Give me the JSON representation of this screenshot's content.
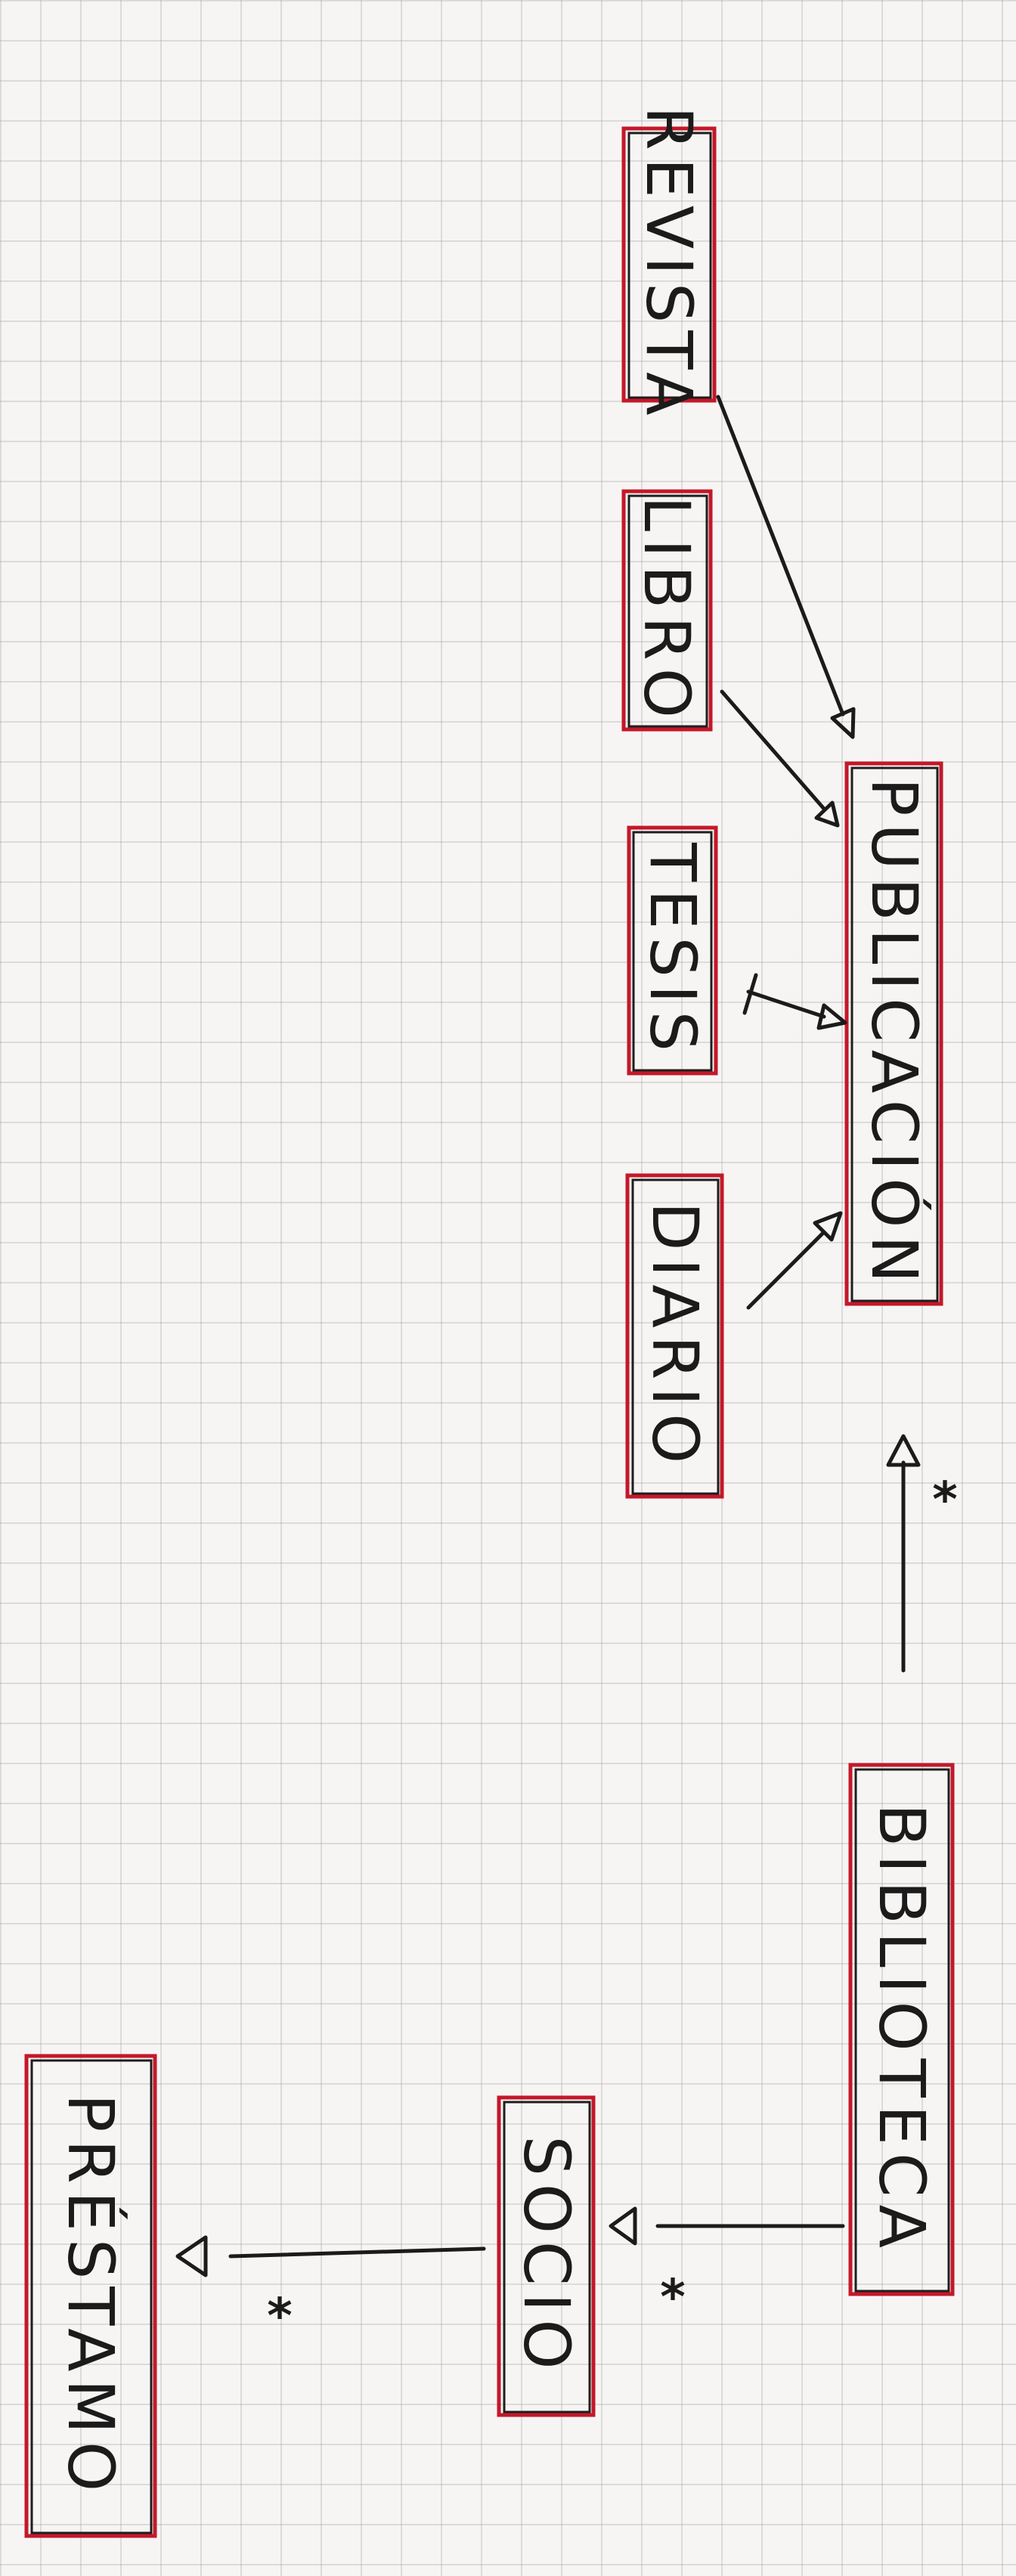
{
  "nodes": {
    "revista": "REVISTA",
    "libro": "LIBRO",
    "tesis": "TESIS",
    "publicacion": "PUBLICACIÓN",
    "diario": "DIARIO",
    "biblioteca": "BIBLIOTECA",
    "socio": "SOCIO",
    "prestamo": "PRÉSTAMO"
  },
  "multiplicities": {
    "biblioteca_publicacion": "*",
    "biblioteca_socio": "*",
    "socio_prestamo": "*"
  }
}
